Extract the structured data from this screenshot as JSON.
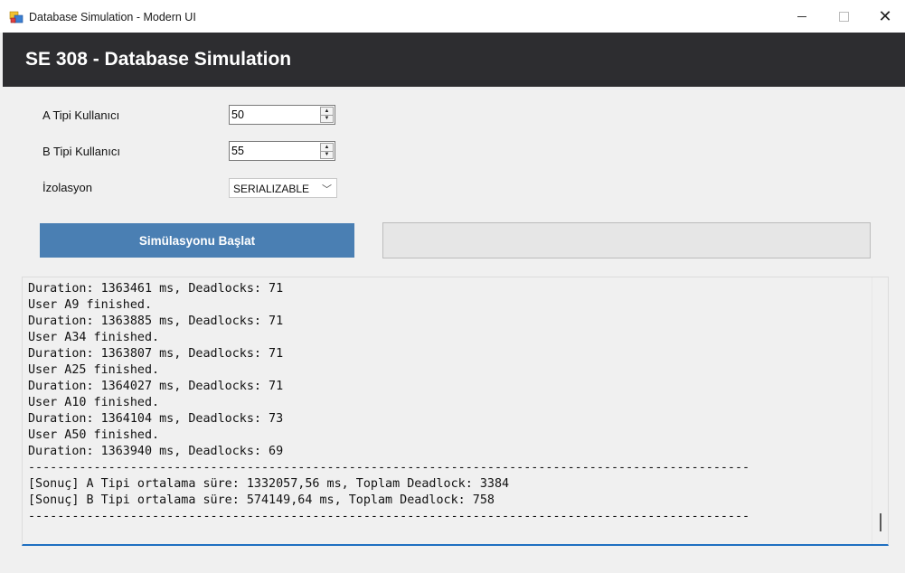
{
  "window": {
    "title": "Database Simulation - Modern UI",
    "controls": {
      "minimize": "minimize-icon",
      "maximize": "maximize-icon",
      "close": "close-icon"
    }
  },
  "header": {
    "title": "SE 308 - Database Simulation"
  },
  "form": {
    "a_label": "A Tipi Kullanıcı",
    "a_value": "50",
    "b_label": "B Tipi Kullanıcı",
    "b_value": "55",
    "isolation_label": "İzolasyon",
    "isolation_value": "SERIALIZABLE"
  },
  "start_button": {
    "label": "Simülasyonu Başlat"
  },
  "progress": {
    "value": 0
  },
  "colors": {
    "header_bg": "#2d2d30",
    "button_bg": "#4a7fb3",
    "log_border": "#1f70c1"
  },
  "log": {
    "lines": [
      "Duration: 1363461 ms, Deadlocks: 71",
      "User A9 finished.",
      "Duration: 1363885 ms, Deadlocks: 71",
      "User A34 finished.",
      "Duration: 1363807 ms, Deadlocks: 71",
      "User A25 finished.",
      "Duration: 1364027 ms, Deadlocks: 71",
      "User A10 finished.",
      "Duration: 1364104 ms, Deadlocks: 73",
      "User A50 finished.",
      "Duration: 1363940 ms, Deadlocks: 69",
      "---------------------------------------------------------------------------------------------------",
      "[Sonuç] A Tipi ortalama süre: 1332057,56 ms, Toplam Deadlock: 3384",
      "[Sonuç] B Tipi ortalama süre: 574149,64 ms, Toplam Deadlock: 758",
      "---------------------------------------------------------------------------------------------------"
    ]
  }
}
